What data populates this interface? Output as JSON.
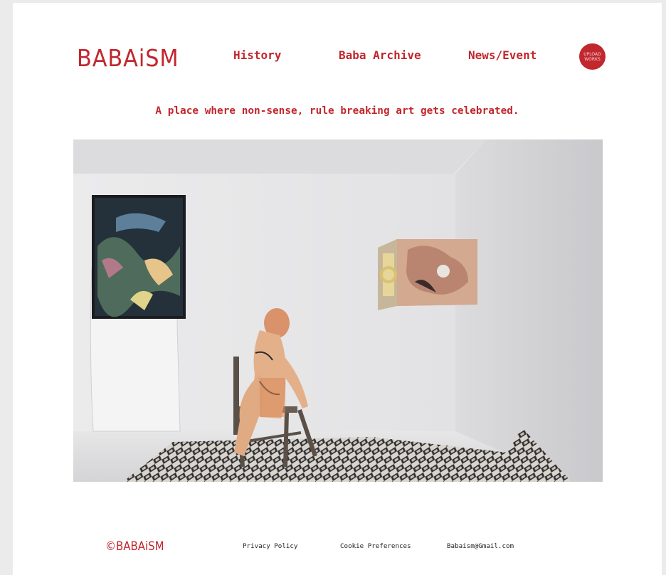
{
  "brand": {
    "logo_text": "BABAiSM",
    "color": "#c1272d"
  },
  "nav": {
    "items": [
      {
        "label": "History"
      },
      {
        "label": "Baba Archive"
      },
      {
        "label": "News/Event"
      }
    ],
    "upload_button": {
      "line1": "UPLOAD",
      "line2": "WORKS"
    }
  },
  "tagline": "A place where non-sense, rule breaking art gets celebrated.",
  "hero": {
    "alt": "Gallery installation photo"
  },
  "footer": {
    "logo_text": "©BABAiSM",
    "links": [
      {
        "label": "Privacy Policy"
      },
      {
        "label": "Cookie Preferences"
      },
      {
        "label": "Babaism@Gmail.com"
      }
    ]
  }
}
